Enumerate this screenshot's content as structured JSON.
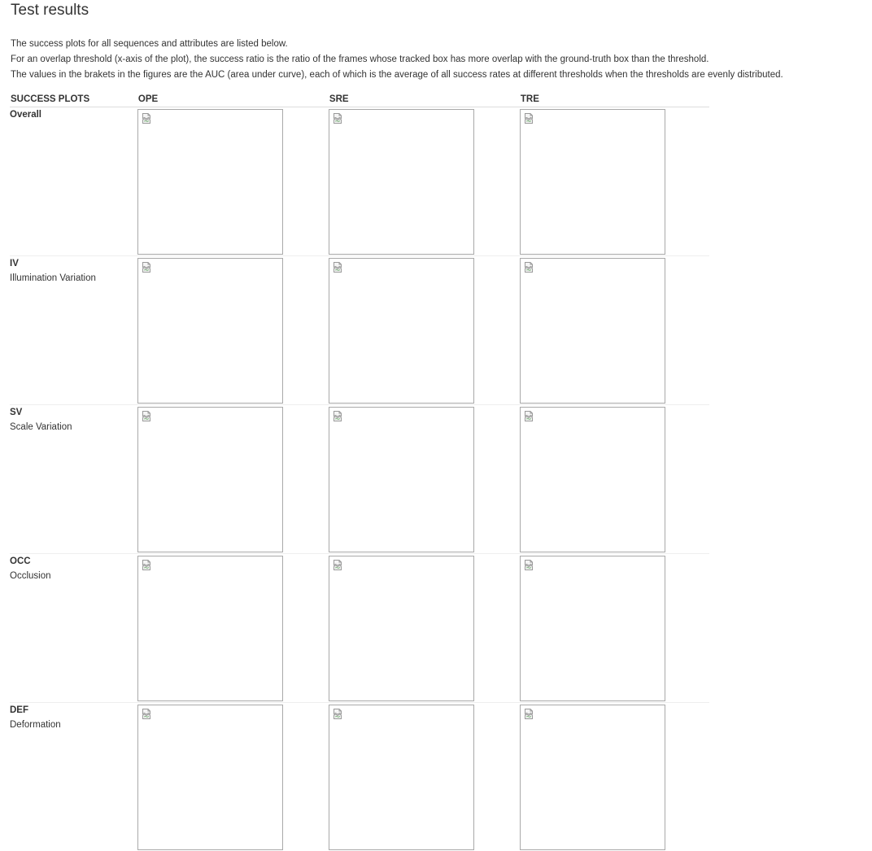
{
  "page": {
    "title": "Test results",
    "intro": [
      "The success plots for all sequences and attributes are listed below.",
      "For an overlap threshold (x-axis of the plot), the success ratio is the ratio of the frames whose tracked box has more overlap with the ground-truth box than the threshold.",
      "The values in the brakets in the figures are the AUC (area under curve), each of which is the average of all success rates at different thresholds when the thresholds are evenly distributed."
    ]
  },
  "table": {
    "headers": [
      "SUCCESS PLOTS",
      "OPE",
      "SRE",
      "TRE"
    ],
    "rows": [
      {
        "code": "Overall",
        "name": ""
      },
      {
        "code": "IV",
        "name": "Illumination Variation"
      },
      {
        "code": "SV",
        "name": "Scale Variation"
      },
      {
        "code": "OCC",
        "name": "Occlusion"
      },
      {
        "code": "DEF",
        "name": "Deformation"
      }
    ]
  },
  "icons": {
    "plot_placeholder": "broken-image-icon"
  },
  "colors": {
    "text": "#333333",
    "frame_border": "#a9a9a9",
    "rule": "#dddddd"
  }
}
